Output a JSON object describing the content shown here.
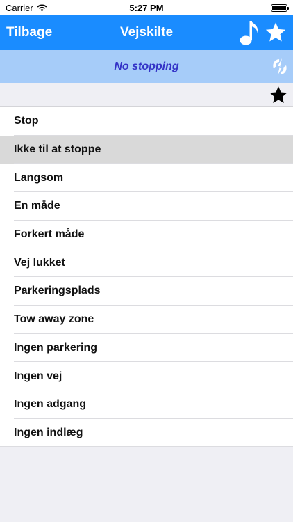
{
  "status_bar": {
    "carrier": "Carrier",
    "time": "5:27 PM"
  },
  "nav": {
    "back_label": "Tilbage",
    "title": "Vejskilte"
  },
  "banner": {
    "text": "No stopping"
  },
  "icons": {
    "music": "music-note-icon",
    "favorites": "star-icon",
    "swap": "swap-icon",
    "add_favorite": "star-icon"
  },
  "colors": {
    "nav_background": "#1a8cff",
    "banner_background": "#a6ccf9",
    "banner_text": "#3433c7",
    "selected_row": "#d9d9d9"
  },
  "list": {
    "selected_index": 1,
    "items": [
      {
        "label": "Stop"
      },
      {
        "label": "Ikke til at stoppe"
      },
      {
        "label": "Langsom"
      },
      {
        "label": "En måde"
      },
      {
        "label": "Forkert måde"
      },
      {
        "label": "Vej lukket"
      },
      {
        "label": "Parkeringsplads"
      },
      {
        "label": "Tow away zone"
      },
      {
        "label": "Ingen parkering"
      },
      {
        "label": "Ingen vej"
      },
      {
        "label": "Ingen adgang"
      },
      {
        "label": "Ingen indlæg"
      }
    ]
  }
}
